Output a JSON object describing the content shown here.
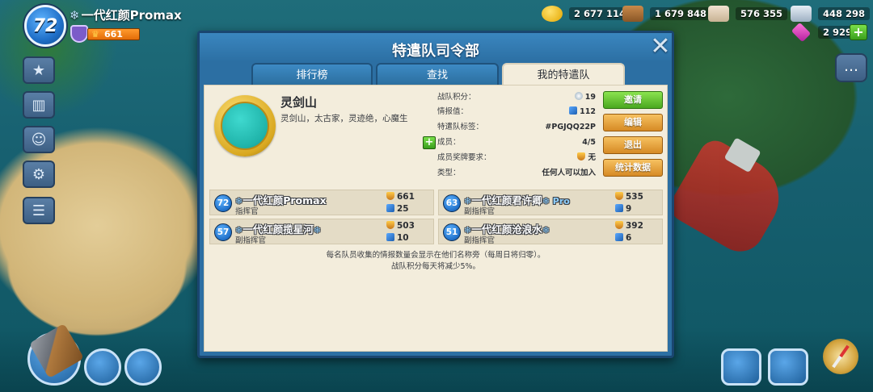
{
  "player": {
    "level": "72",
    "name": "一代红颜Promax",
    "snow": "❄",
    "medals": "661"
  },
  "resources": {
    "gold": "2 677 114",
    "wood": "1 679 848",
    "stone": "576 355",
    "iron": "448 298",
    "diamonds": "2 929",
    "plus": "+"
  },
  "dialog": {
    "title": "特遣队司令部",
    "close": "✕",
    "tabs": [
      {
        "label": "排行榜"
      },
      {
        "label": "查找"
      },
      {
        "label": "我的特遣队"
      }
    ]
  },
  "taskforce": {
    "name": "灵剑山",
    "description": "灵剑山，太古家，灵迹绝，心魔生",
    "stats": [
      {
        "label": "战队积分：",
        "value": "19",
        "icon": "score-icon"
      },
      {
        "label": "情报值：",
        "value": "112",
        "icon": "intel-icon"
      },
      {
        "label": "特遣队标签：",
        "value": "#PGJQQ22P",
        "icon": ""
      },
      {
        "label": "成员：",
        "value": "4/5",
        "icon": ""
      },
      {
        "label": "成员奖牌要求：",
        "value": "无",
        "icon": "medal-icon"
      },
      {
        "label": "类型：",
        "value": "任何人可以加入",
        "icon": ""
      }
    ],
    "add_member": "+",
    "buttons": {
      "invite": "邀请",
      "edit": "编辑",
      "leave": "退出",
      "stats": "统计数据"
    }
  },
  "members": [
    {
      "level": "72",
      "name": "一代红颜Promax",
      "prefix": "❄",
      "suffix": "",
      "role": "指挥官",
      "medals": "661",
      "intel": "25"
    },
    {
      "level": "63",
      "name": "一代红颜君许卿",
      "prefix": "❄",
      "suffix": "❄ Pro",
      "role": "副指挥官",
      "medals": "535",
      "intel": "9"
    },
    {
      "level": "57",
      "name": "一代红颜揽星河",
      "prefix": "❄",
      "suffix": "❄",
      "role": "副指挥官",
      "medals": "503",
      "intel": "10"
    },
    {
      "level": "51",
      "name": "一代红颜沧浪水",
      "prefix": "❄",
      "suffix": "❄",
      "role": "副指挥官",
      "medals": "392",
      "intel": "6"
    }
  ],
  "footnote": {
    "line1": "每名队员收集的情报数量会显示在他们名称旁（每周日将归零）。",
    "line2": "战队积分每天将减少5%。"
  },
  "colors": {
    "dialog_blue": "#2c6fa3",
    "panel_cream": "#f3eddc",
    "invite_green": "#6cc738",
    "action_orange": "#e8a63c"
  }
}
